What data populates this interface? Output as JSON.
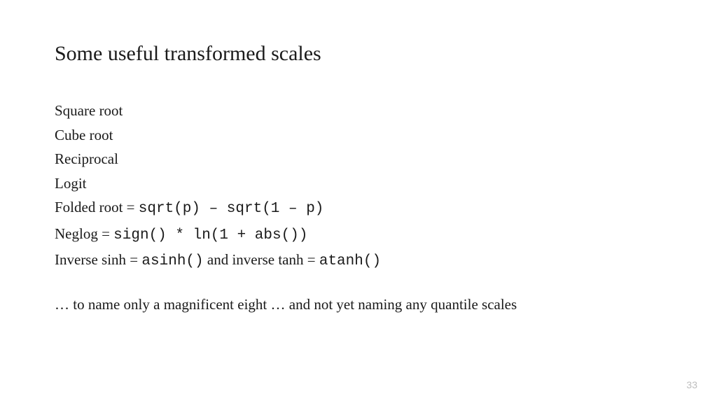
{
  "title": "Some useful transformed scales",
  "lines": {
    "l1": "Square root",
    "l2": "Cube root",
    "l3": "Reciprocal",
    "l4": "Logit",
    "l5_prefix": "Folded root = ",
    "l5_code": "sqrt(p) – sqrt(1 – p)",
    "l6_prefix": "Neglog = ",
    "l6_code": "sign() * ln(1 + abs())",
    "l7_prefix": "Inverse sinh = ",
    "l7_code1": "asinh()",
    "l7_mid": "  and inverse tanh = ",
    "l7_code2": "atanh()"
  },
  "closing": "… to name only a magnificent eight … and not yet naming any quantile scales",
  "page_number": "33"
}
